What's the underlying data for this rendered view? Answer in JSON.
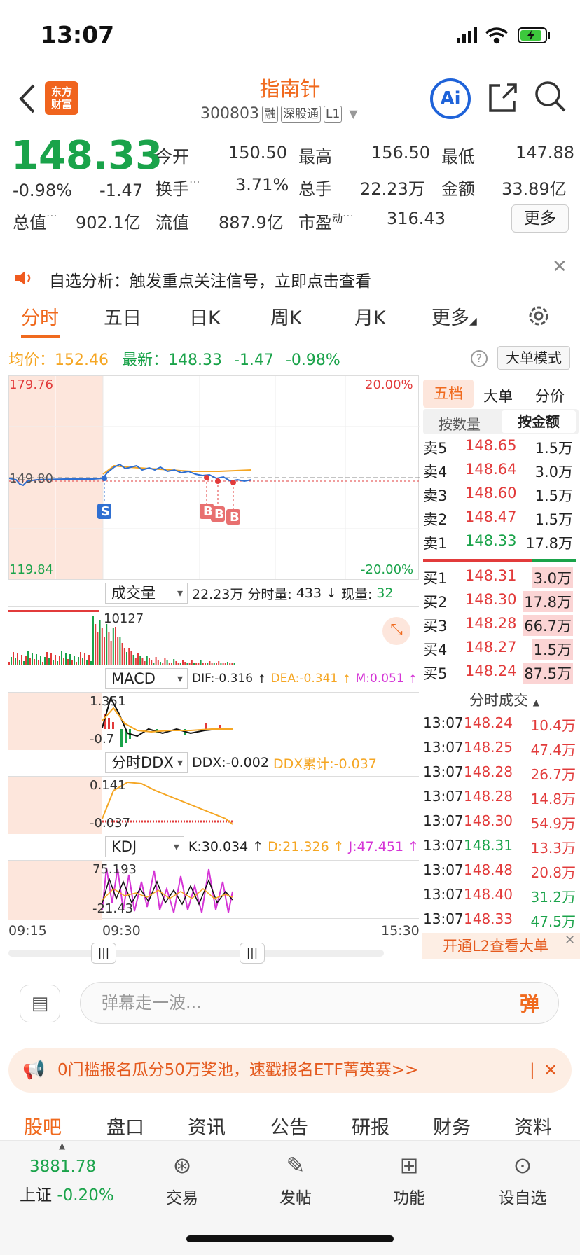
{
  "status": {
    "time": "13:07"
  },
  "header": {
    "logo_text": "东方财富",
    "stock_name": "指南针",
    "stock_code": "300803",
    "tags": [
      "融",
      "深股通",
      "L1"
    ],
    "ai_label": "Ai"
  },
  "quote": {
    "price": "148.33",
    "change_pct": "-0.98%",
    "change": "-1.47",
    "open_label": "今开",
    "open": "150.50",
    "high_label": "最高",
    "high": "156.50",
    "low_label": "最低",
    "low": "147.88",
    "turnover_label": "换手",
    "turnover": "3.71%",
    "volume_label": "总手",
    "volume": "22.23万",
    "amount_label": "金额",
    "amount": "33.89亿",
    "mcap_label": "总值",
    "mcap": "902.1亿",
    "float_label": "流值",
    "float": "887.9亿",
    "pe_label": "市盈",
    "pe_sup": "动",
    "pe": "316.43",
    "more_label": "更多"
  },
  "banner": {
    "text": "自选分析：触发重点关注信号，立即点击查看"
  },
  "tabs": [
    "分时",
    "五日",
    "日K",
    "周K",
    "月K",
    "更多"
  ],
  "infoline": {
    "avg_label": "均价：",
    "avg": "152.46",
    "latest_label": "最新：",
    "latest": "148.33",
    "change": "-1.47",
    "pct": "-0.98%",
    "big_mode": "大单模式"
  },
  "chart": {
    "y_max": "179.76",
    "y_mid": "149.80",
    "y_min": "119.84",
    "pct_max": "20.00%",
    "pct_min": "-20.00%",
    "markers": [
      "S",
      "B",
      "B",
      "B"
    ],
    "time_labels": [
      "09:15",
      "09:30",
      "15:30"
    ]
  },
  "indicators": {
    "vol": {
      "name": "成交量",
      "total": "22.23万",
      "fen_label": "分时量:",
      "fen": "433",
      "xian_label": "现量:",
      "xian": "32",
      "peak": "10127"
    },
    "macd": {
      "name": "MACD",
      "dif": "DIF:-0.316",
      "dea": "DEA:-0.341",
      "m": "M:0.051",
      "hi": "1.351",
      "lo": "-0.7"
    },
    "ddx": {
      "name": "分时DDX",
      "ddx": "DDX:-0.002",
      "sum": "DDX累计:-0.037",
      "hi": "0.141",
      "lo": "-0.037"
    },
    "kdj": {
      "name": "KDJ",
      "k": "K:30.034",
      "d": "D:21.326",
      "j": "J:47.451",
      "hi": "75.193",
      "lo": "-21.43"
    }
  },
  "orderbook": {
    "tabs": [
      "五档",
      "大单",
      "分价"
    ],
    "subtabs": [
      "按数量",
      "按金额"
    ],
    "asks": [
      {
        "label": "卖5",
        "price": "148.65",
        "vol": "1.5万"
      },
      {
        "label": "卖4",
        "price": "148.64",
        "vol": "3.0万"
      },
      {
        "label": "卖3",
        "price": "148.60",
        "vol": "1.5万"
      },
      {
        "label": "卖2",
        "price": "148.47",
        "vol": "1.5万"
      },
      {
        "label": "卖1",
        "price": "148.33",
        "vol": "17.8万"
      }
    ],
    "bids": [
      {
        "label": "买1",
        "price": "148.31",
        "vol": "3.0万"
      },
      {
        "label": "买2",
        "price": "148.30",
        "vol": "17.8万"
      },
      {
        "label": "买3",
        "price": "148.28",
        "vol": "66.7万"
      },
      {
        "label": "买4",
        "price": "148.27",
        "vol": "1.5万"
      },
      {
        "label": "买5",
        "price": "148.24",
        "vol": "87.5万"
      }
    ],
    "ticks_title": "分时成交",
    "ticks": [
      {
        "time": "13:07",
        "price": "148.24",
        "vol": "10.4万"
      },
      {
        "time": "13:07",
        "price": "148.25",
        "vol": "47.4万"
      },
      {
        "time": "13:07",
        "price": "148.28",
        "vol": "26.7万"
      },
      {
        "time": "13:07",
        "price": "148.28",
        "vol": "14.8万"
      },
      {
        "time": "13:07",
        "price": "148.30",
        "vol": "54.9万"
      },
      {
        "time": "13:07",
        "price": "148.31",
        "vol": "13.3万"
      },
      {
        "time": "13:07",
        "price": "148.48",
        "vol": "20.8万"
      },
      {
        "time": "13:07",
        "price": "148.40",
        "vol": "31.2万"
      },
      {
        "time": "13:07",
        "price": "148.33",
        "vol": "47.5万"
      }
    ],
    "l2_text": "开通L2查看大单"
  },
  "danmu": {
    "placeholder": "弹幕走一波...",
    "btn": "弹"
  },
  "promo": {
    "text": "0门槛报名瓜分50万奖池，速戳报名ETF菁英赛>>"
  },
  "subtabs": [
    "股吧",
    "盘口",
    "资讯",
    "公告",
    "研报",
    "财务",
    "资料"
  ],
  "bottom": {
    "index_value": "3881.78",
    "index_name": "上证",
    "index_change": "-0.20%",
    "items": [
      "交易",
      "发帖",
      "功能",
      "设自选"
    ]
  },
  "colors": {
    "up": "#e23b3b",
    "down": "#1aa34a",
    "accent": "#f06a1e",
    "avg": "#f5a623"
  }
}
